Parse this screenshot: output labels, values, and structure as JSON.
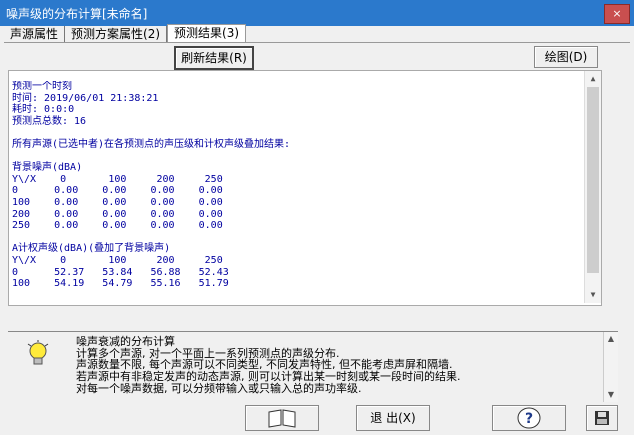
{
  "window": {
    "title": "噪声级的分布计算[未命名]",
    "close_label": "×"
  },
  "tabs": [
    {
      "label": "声源属性"
    },
    {
      "label": "预测方案属性(2)"
    },
    {
      "label": "预测结果(3)"
    }
  ],
  "toolbar": {
    "refresh_label": "刷新结果(R)",
    "chart_label": "绘图(D)"
  },
  "results": {
    "lines": [
      "预测一个时刻",
      "时间: 2019/06/01 21:38:21",
      "耗时: 0:0:0",
      "预测点总数: 16",
      "",
      "所有声源(已选中者)在各预测点的声压级和计权声级叠加结果:",
      "",
      "背景噪声(dBA)",
      "Y\\/X    0       100     200     250",
      "0      0.00    0.00    0.00    0.00",
      "100    0.00    0.00    0.00    0.00",
      "200    0.00    0.00    0.00    0.00",
      "250    0.00    0.00    0.00    0.00",
      "",
      "A计权声级(dBA)(叠加了背景噪声)",
      "Y\\/X    0       100     200     250",
      "0      52.37   53.84   56.88   52.43",
      "100    54.19   54.79   55.16   51.79"
    ]
  },
  "info": {
    "title": "噪声衰减的分布计算",
    "lines": [
      "计算多个声源, 对一个平面上一系列预测点的声级分布.",
      "声源数量不限, 每个声源可以不同类型, 不同发声特性, 但不能考虑声屏和隔墙.",
      "若声源中有非稳定发声的动态声源, 则可以计算出某一时刻或某一段时间的结果.",
      "对每一个噪声数据, 可以分频带输入或只输入总的声功率级."
    ]
  },
  "bottom": {
    "exit_label": "退 出(X)"
  }
}
